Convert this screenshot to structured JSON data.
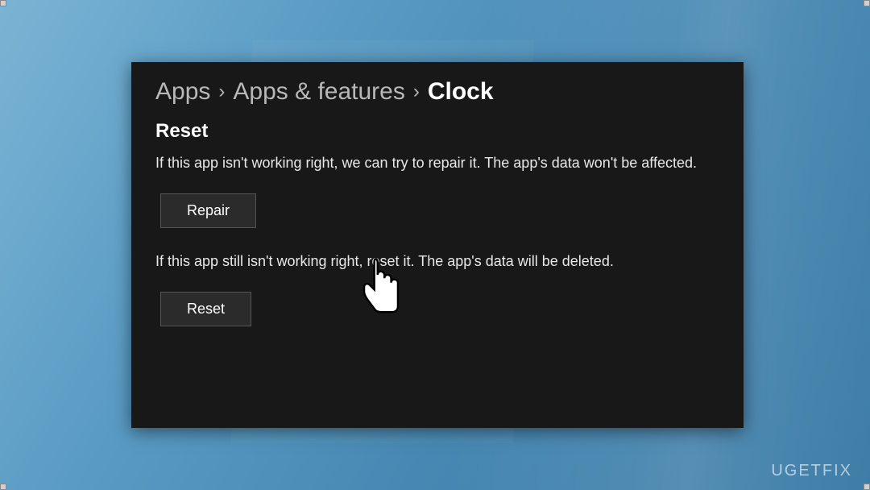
{
  "breadcrumb": {
    "items": [
      {
        "label": "Apps",
        "current": false
      },
      {
        "label": "Apps & features",
        "current": false
      },
      {
        "label": "Clock",
        "current": true
      }
    ],
    "separator": "›"
  },
  "section": {
    "heading": "Reset",
    "repair_description": "If this app isn't working right, we can try to repair it. The app's data won't be affected.",
    "repair_button": "Repair",
    "reset_description": "If this app still isn't working right, reset it. The app's data will be deleted.",
    "reset_button": "Reset"
  },
  "watermark": "UGETFIX",
  "colors": {
    "panel_bg": "#181818",
    "button_bg": "#2b2b2b",
    "button_border": "#545454",
    "text_primary": "#ffffff",
    "text_muted": "#b8b8b8"
  }
}
